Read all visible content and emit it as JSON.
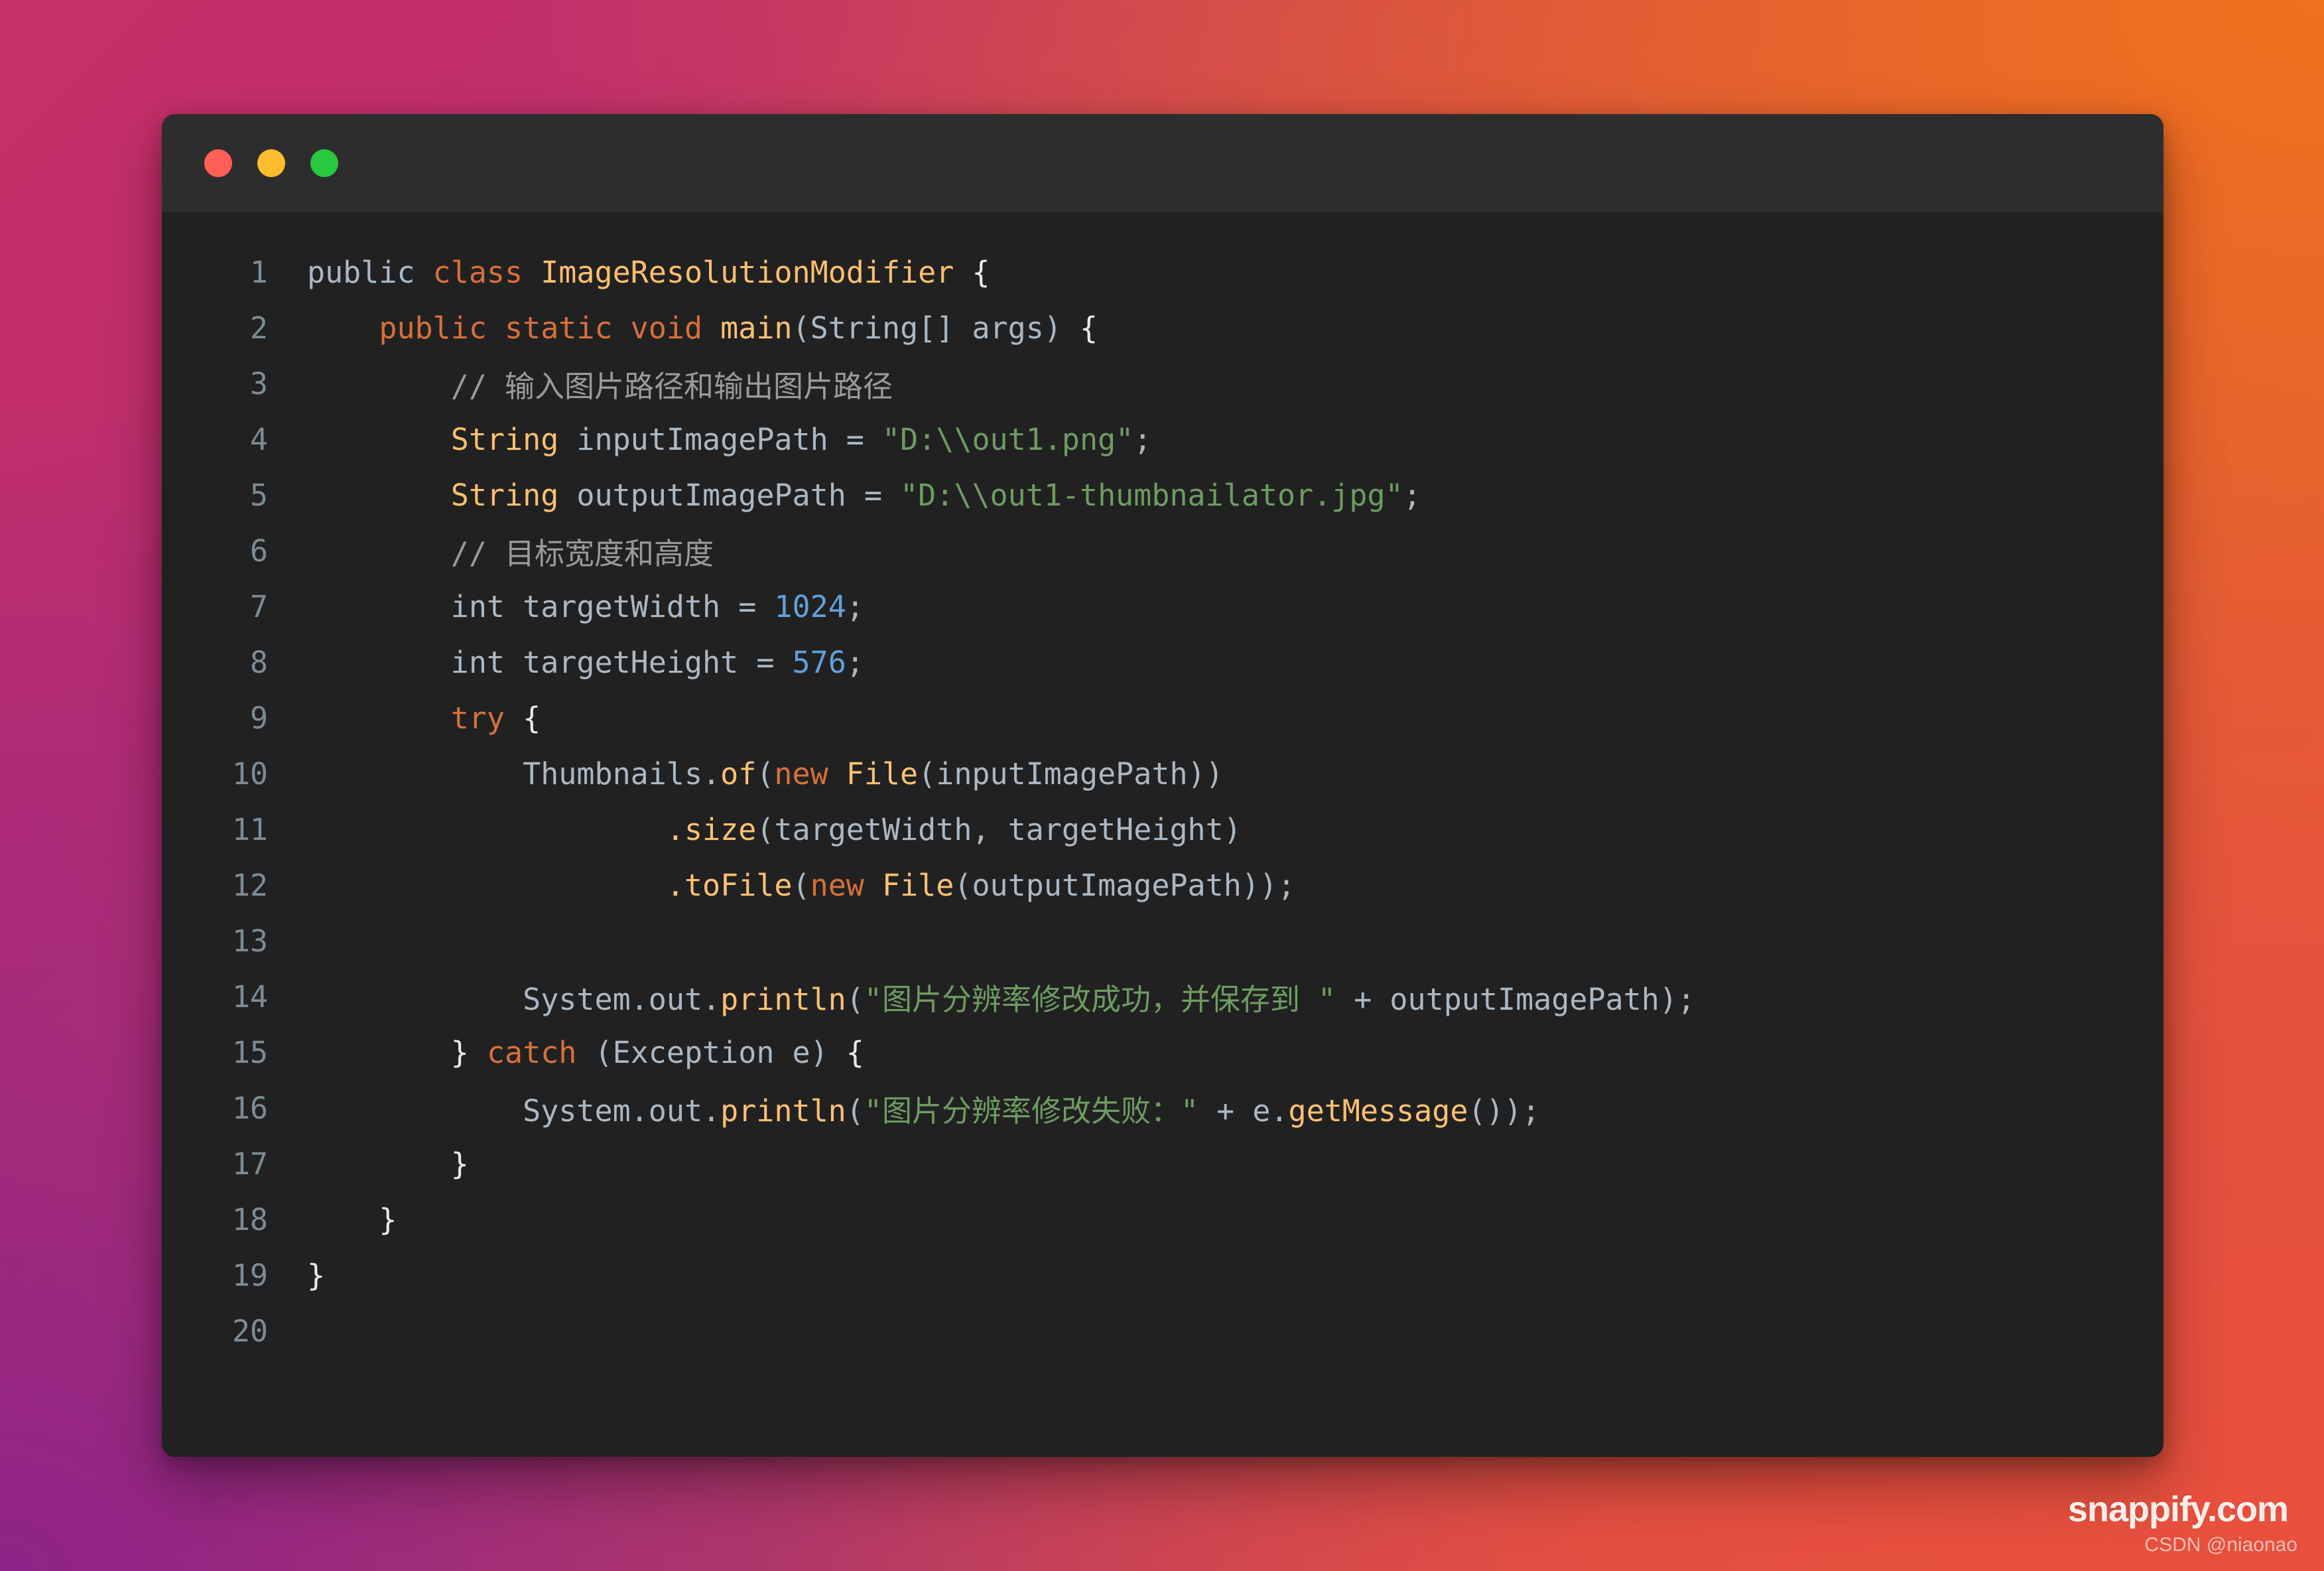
{
  "window": {
    "traffic_lights": [
      {
        "name": "close",
        "color": "#FF5F57"
      },
      {
        "name": "minimize",
        "color": "#FEBC2E"
      },
      {
        "name": "maximize",
        "color": "#28C840"
      }
    ],
    "editor_background": "#212121",
    "titlebar_background": "#2D2D2D"
  },
  "watermark": {
    "brand": "snappify.com",
    "credit": "CSDN @niaonao"
  },
  "editor": {
    "language": "java",
    "line_count": 20,
    "line_numbers": [
      "1",
      "2",
      "3",
      "4",
      "5",
      "6",
      "7",
      "8",
      "9",
      "10",
      "11",
      "12",
      "13",
      "14",
      "15",
      "16",
      "17",
      "18",
      "19",
      "20"
    ],
    "lines": [
      {
        "n": "1",
        "text": "public class ImageResolutionModifier {"
      },
      {
        "n": "2",
        "text": "    public static void main(String[] args) {"
      },
      {
        "n": "3",
        "text": "        // 输入图片路径和输出图片路径"
      },
      {
        "n": "4",
        "text": "        String inputImagePath = \"D:\\\\out1.png\";"
      },
      {
        "n": "5",
        "text": "        String outputImagePath = \"D:\\\\out1-thumbnailator.jpg\";"
      },
      {
        "n": "6",
        "text": "        // 目标宽度和高度"
      },
      {
        "n": "7",
        "text": "        int targetWidth = 1024;"
      },
      {
        "n": "8",
        "text": "        int targetHeight = 576;"
      },
      {
        "n": "9",
        "text": "        try {"
      },
      {
        "n": "10",
        "text": "            Thumbnails.of(new File(inputImagePath))"
      },
      {
        "n": "11",
        "text": "                    .size(targetWidth, targetHeight)"
      },
      {
        "n": "12",
        "text": "                    .toFile(new File(outputImagePath));"
      },
      {
        "n": "13",
        "text": ""
      },
      {
        "n": "14",
        "text": "            System.out.println(\"图片分辨率修改成功，并保存到 \" + outputImagePath);"
      },
      {
        "n": "15",
        "text": "        } catch (Exception e) {"
      },
      {
        "n": "16",
        "text": "            System.out.println(\"图片分辨率修改失败：\" + e.getMessage());"
      },
      {
        "n": "17",
        "text": "        }"
      },
      {
        "n": "18",
        "text": "    }"
      },
      {
        "n": "19",
        "text": "}"
      },
      {
        "n": "20",
        "text": ""
      }
    ],
    "token_colors": {
      "keyword": "#D7703A",
      "type": "#FBBF6E",
      "function": "#FDC172",
      "string": "#6E9B62",
      "number": "#62A0D8",
      "comment": "#9A9A9A",
      "plain": "#ABB8C3",
      "brace": "#E8E8E8",
      "line_number": "#7D8B94"
    }
  },
  "background": {
    "top_left": "#C72F67",
    "top_right": "#F1711D",
    "bottom_left": "#8E2388",
    "bottom_right": "#E8503E"
  }
}
